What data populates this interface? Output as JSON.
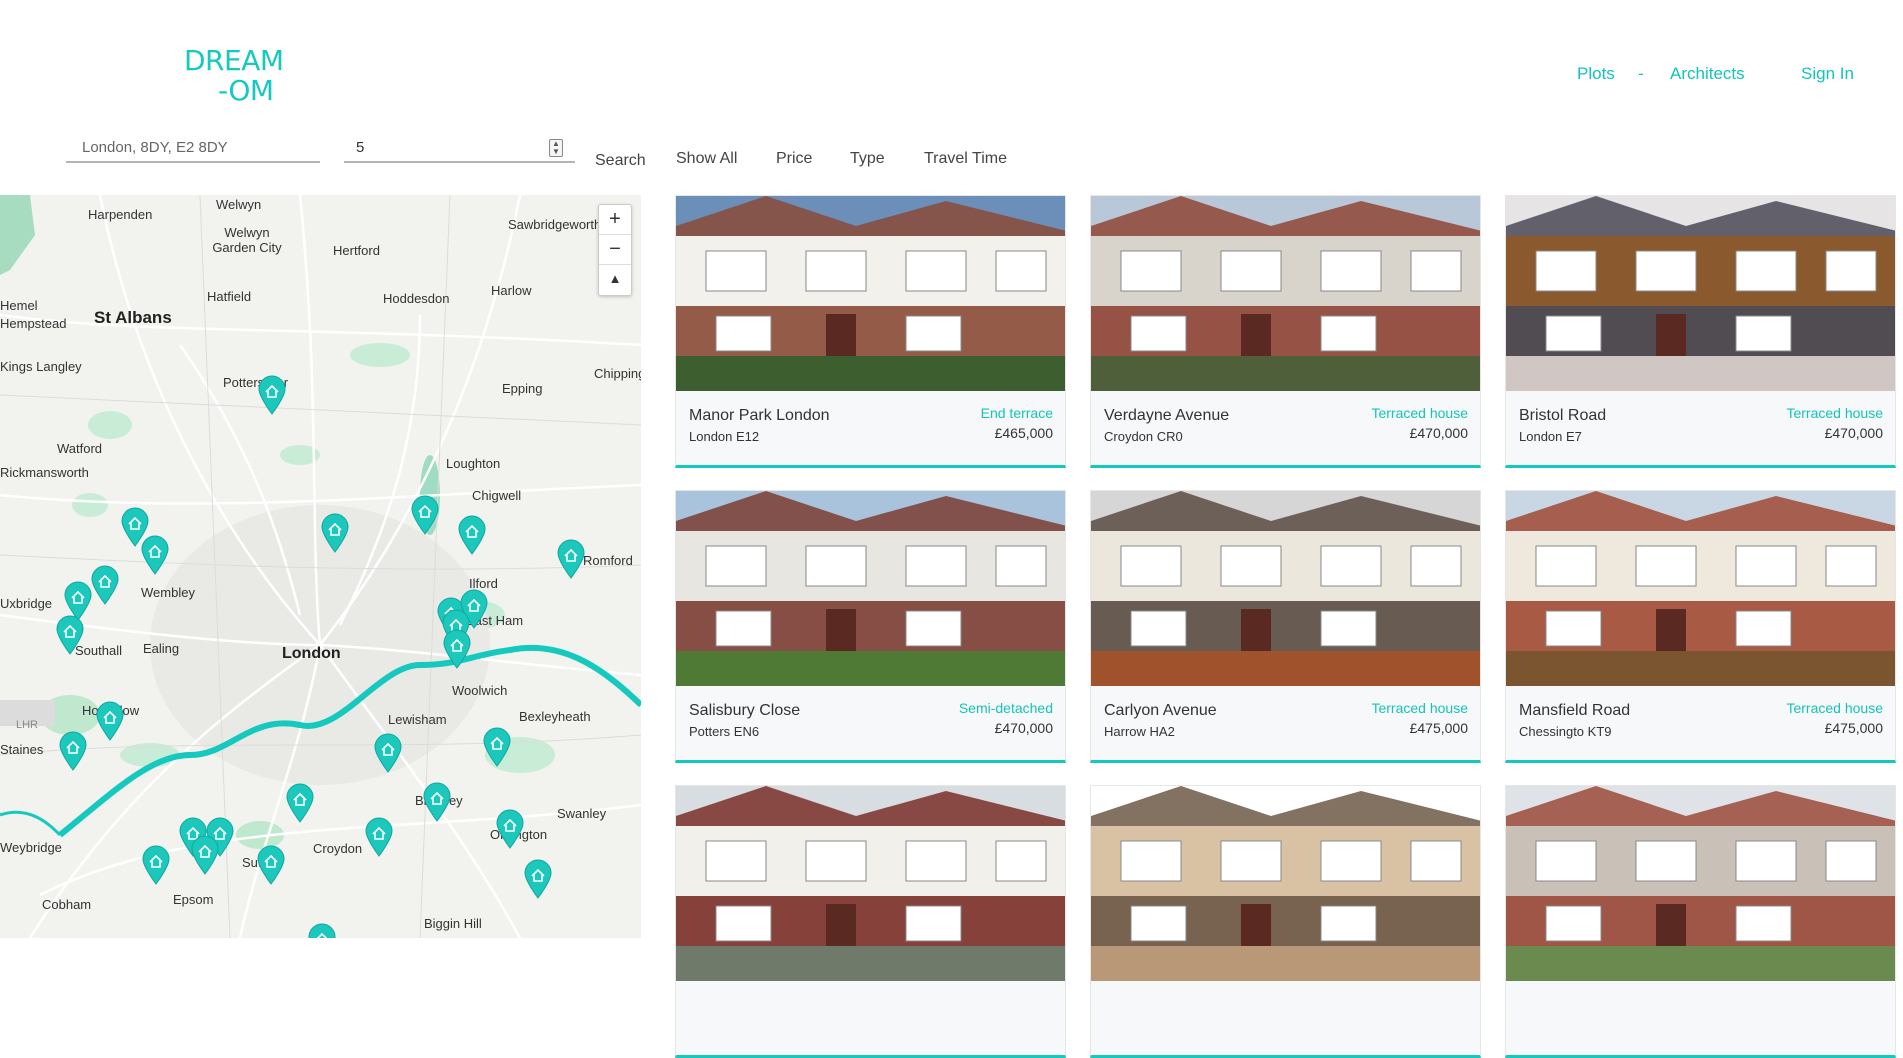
{
  "brand": {
    "line1": "DREAM",
    "line2": "-OM"
  },
  "nav": {
    "plots": "Plots",
    "separator": "-",
    "architects": "Architects",
    "sign_in": "Sign In"
  },
  "search": {
    "location_value": "London, 8DY, E2 8DY",
    "radius_value": "5",
    "button": "Search"
  },
  "filters": [
    "Show All",
    "Price",
    "Type",
    "Travel Time"
  ],
  "map": {
    "zoom_in": "+",
    "zoom_out": "−",
    "reset": "▲",
    "labels": [
      "Harpenden",
      "Welwyn",
      "Welwyn Garden City",
      "Hertford",
      "Sawbridgeworth",
      "Hemel",
      "Hempstead",
      "St Albans",
      "Hatfield",
      "Hoddesdon",
      "Harlow",
      "Kings Langley",
      "Potters Bar",
      "Chipping",
      "Epping",
      "Watford",
      "Rickmansworth",
      "Loughton",
      "Chigwell",
      "Wembley",
      "Ilford",
      "Romford",
      "Uxbridge",
      "Southall",
      "Ealing",
      "London",
      "East Ham",
      "Woolwich",
      "Hounslow",
      "LHR",
      "Lewisham",
      "Bexleyheath",
      "Staines",
      "Bromley",
      "Swanley",
      "Weybridge",
      "Croydon",
      "Sutton",
      "Orpington",
      "Cobham",
      "Epsom",
      "Biggin Hill"
    ],
    "accent": "#1cc7bb"
  },
  "listings": [
    {
      "name": "Manor Park London",
      "area": "London E12",
      "type": "End terrace",
      "price": "£465,000",
      "palette": [
        "#6b8fb8",
        "#f2f1ec",
        "#8a4a36",
        "#3d5e2f"
      ]
    },
    {
      "name": "Verdayne Avenue",
      "area": "Croydon CR0",
      "type": "Terraced house",
      "price": "£470,000",
      "palette": [
        "#b9c8d8",
        "#d8d4cc",
        "#8f4536",
        "#4f5f3a"
      ]
    },
    {
      "name": "Bristol Road",
      "area": "London E7",
      "type": "Terraced house",
      "price": "£470,000",
      "palette": [
        "#e7e4e6",
        "#8a5a2e",
        "#4a4a55",
        "#d0c7c4"
      ]
    },
    {
      "name": "Salisbury Close",
      "area": "Potters EN6",
      "type": "Semi-detached",
      "price": "£470,000",
      "palette": [
        "#a9c3dd",
        "#e8e6e0",
        "#7b3d33",
        "#4f7a35"
      ]
    },
    {
      "name": "Carlyon Avenue",
      "area": "Harrow HA2",
      "type": "Terraced house",
      "price": "£475,000",
      "palette": [
        "#d6d6d6",
        "#ece7dc",
        "#5a4b43",
        "#a0522d"
      ]
    },
    {
      "name": "Mansfield Road",
      "area": "Chessingto KT9",
      "type": "Terraced house",
      "price": "£475,000",
      "palette": [
        "#c9d6e3",
        "#efe9dd",
        "#a04a34",
        "#7a5530"
      ]
    },
    {
      "name": "",
      "area": "",
      "type": "",
      "price": "",
      "palette": [
        "#d8dde2",
        "#f2f0ea",
        "#7a2e28",
        "#6f7a6a"
      ]
    },
    {
      "name": "",
      "area": "",
      "type": "",
      "price": "",
      "palette": [
        "#ffffff",
        "#d9c2a3",
        "#6d5847",
        "#b99878"
      ]
    },
    {
      "name": "",
      "area": "",
      "type": "",
      "price": "",
      "palette": [
        "#dfe3e8",
        "#c9c1b8",
        "#9a4a3a",
        "#6b8a4f"
      ]
    }
  ]
}
